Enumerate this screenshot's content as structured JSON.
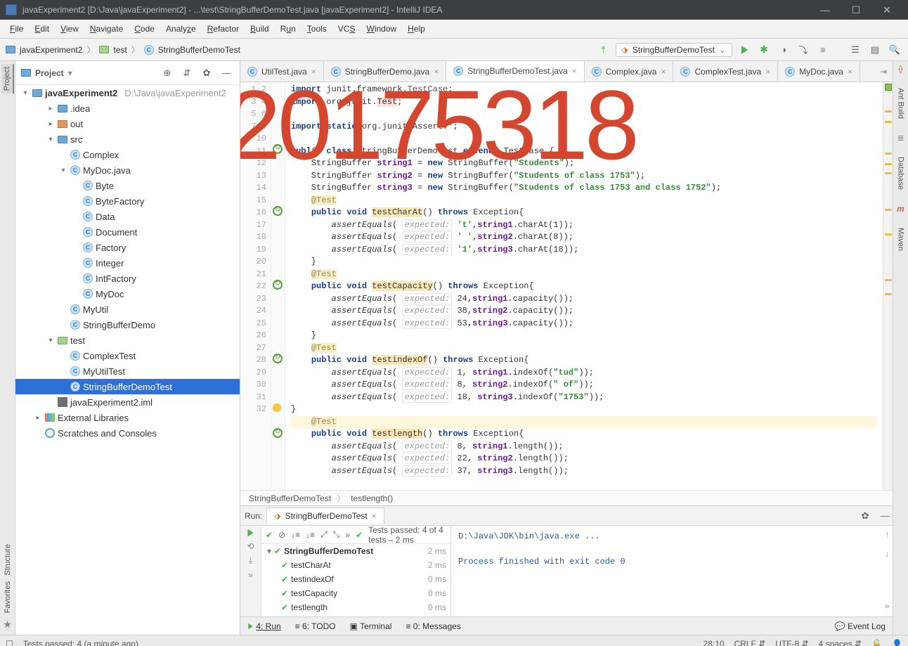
{
  "title": "javaExperiment2 [D:\\Java\\javaExperiment2] - ...\\test\\StringBufferDemoTest.java [javaExperiment2] - IntelliJ IDEA",
  "menubar": [
    "File",
    "Edit",
    "View",
    "Navigate",
    "Code",
    "Analyze",
    "Refactor",
    "Build",
    "Run",
    "Tools",
    "VCS",
    "Window",
    "Help"
  ],
  "navbar": {
    "project": "javaExperiment2",
    "folder": "test",
    "class": "StringBufferDemoTest"
  },
  "runconfig": "StringBufferDemoTest",
  "project": {
    "label": "Project",
    "root": "javaExperiment2",
    "rootPath": "D:\\Java\\javaExperiment2",
    "items": [
      {
        "t": "folder",
        "name": ".idea",
        "ind": 2,
        "exp": false
      },
      {
        "t": "folder-o",
        "name": "out",
        "ind": 2,
        "exp": false
      },
      {
        "t": "folder",
        "name": "src",
        "ind": 2,
        "exp": true
      },
      {
        "t": "class",
        "name": "Complex",
        "ind": 3
      },
      {
        "t": "class",
        "name": "MyDoc.java",
        "ind": 3,
        "exp": true
      },
      {
        "t": "class",
        "name": "Byte",
        "ind": 4
      },
      {
        "t": "class",
        "name": "ByteFactory",
        "ind": 4
      },
      {
        "t": "class",
        "name": "Data",
        "ind": 4
      },
      {
        "t": "class",
        "name": "Document",
        "ind": 4
      },
      {
        "t": "class",
        "name": "Factory",
        "ind": 4
      },
      {
        "t": "class",
        "name": "Integer",
        "ind": 4
      },
      {
        "t": "class",
        "name": "IntFactory",
        "ind": 4
      },
      {
        "t": "class",
        "name": "MyDoc",
        "ind": 4
      },
      {
        "t": "class",
        "name": "MyUtil",
        "ind": 3
      },
      {
        "t": "class",
        "name": "StringBufferDemo",
        "ind": 3
      },
      {
        "t": "folder-g",
        "name": "test",
        "ind": 2,
        "exp": true
      },
      {
        "t": "class",
        "name": "ComplexTest",
        "ind": 3
      },
      {
        "t": "class",
        "name": "MyUtilTest",
        "ind": 3
      },
      {
        "t": "class",
        "name": "StringBufferDemoTest",
        "ind": 3,
        "sel": true
      },
      {
        "t": "iml",
        "name": "javaExperiment2.iml",
        "ind": 2
      },
      {
        "t": "lib",
        "name": "External Libraries",
        "ind": 1,
        "exp": false
      },
      {
        "t": "scratch",
        "name": "Scratches and Consoles",
        "ind": 1
      }
    ]
  },
  "tabs": [
    {
      "label": "UtilTest.java"
    },
    {
      "label": "StringBufferDemo.java"
    },
    {
      "label": "StringBufferDemoTest.java",
      "active": true
    },
    {
      "label": "Complex.java"
    },
    {
      "label": "ComplexTest.java"
    },
    {
      "label": "MyDoc.java"
    }
  ],
  "lines": {
    "start": 1,
    "end": 32
  },
  "breadcrumbs": [
    "StringBufferDemoTest",
    "testlength()"
  ],
  "run": {
    "label": "Run:",
    "config": "StringBufferDemoTest",
    "passmsg": "Tests passed: 4 of 4 tests – 2 ms",
    "tree": [
      {
        "name": "StringBufferDemoTest",
        "ms": "2 ms",
        "bold": true
      },
      {
        "name": "testCharAt",
        "ms": "2 ms"
      },
      {
        "name": "testindexOf",
        "ms": "0 ms"
      },
      {
        "name": "testCapacity",
        "ms": "0 ms"
      },
      {
        "name": "testlength",
        "ms": "0 ms"
      }
    ],
    "console": {
      "l1": "D:\\Java\\JDK\\bin\\java.exe ...",
      "l2": "Process finished with exit code 0"
    }
  },
  "bottomtabs": {
    "run": "4: Run",
    "todo": "6: TODO",
    "terminal": "Terminal",
    "messages": "0: Messages",
    "eventlog": "Event Log"
  },
  "status": {
    "msg": "Tests passed: 4 (a minute ago)",
    "pos": "28:10",
    "crlf": "CRLF",
    "enc": "UTF-8",
    "indent": "4 spaces"
  },
  "rightbar": [
    "Ant Build",
    "Database",
    "Maven"
  ],
  "leftbar": [
    "Project",
    "Structure",
    "Favorites"
  ],
  "watermark": "20175318"
}
